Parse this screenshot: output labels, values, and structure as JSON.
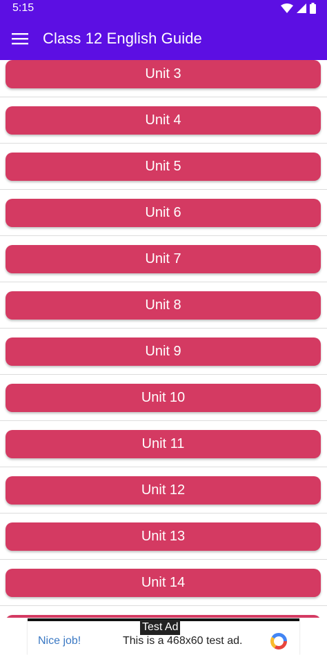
{
  "status_bar": {
    "time": "5:15",
    "icons": [
      "wifi-icon",
      "signal-icon",
      "battery-icon"
    ]
  },
  "app_bar": {
    "title": "Class 12 English Guide",
    "menu_icon": "hamburger-menu-icon"
  },
  "units": [
    "Unit 3",
    "Unit 4",
    "Unit 5",
    "Unit 6",
    "Unit 7",
    "Unit 8",
    "Unit 9",
    "Unit 10",
    "Unit 11",
    "Unit 12",
    "Unit 13",
    "Unit 14"
  ],
  "ad": {
    "label": "Test Ad",
    "nice_job": "Nice job!",
    "text": "This is a 468x60 test ad."
  },
  "colors": {
    "primary": "#5c0fe3",
    "button": "#d43a62",
    "ad_link": "#3a78c3"
  }
}
